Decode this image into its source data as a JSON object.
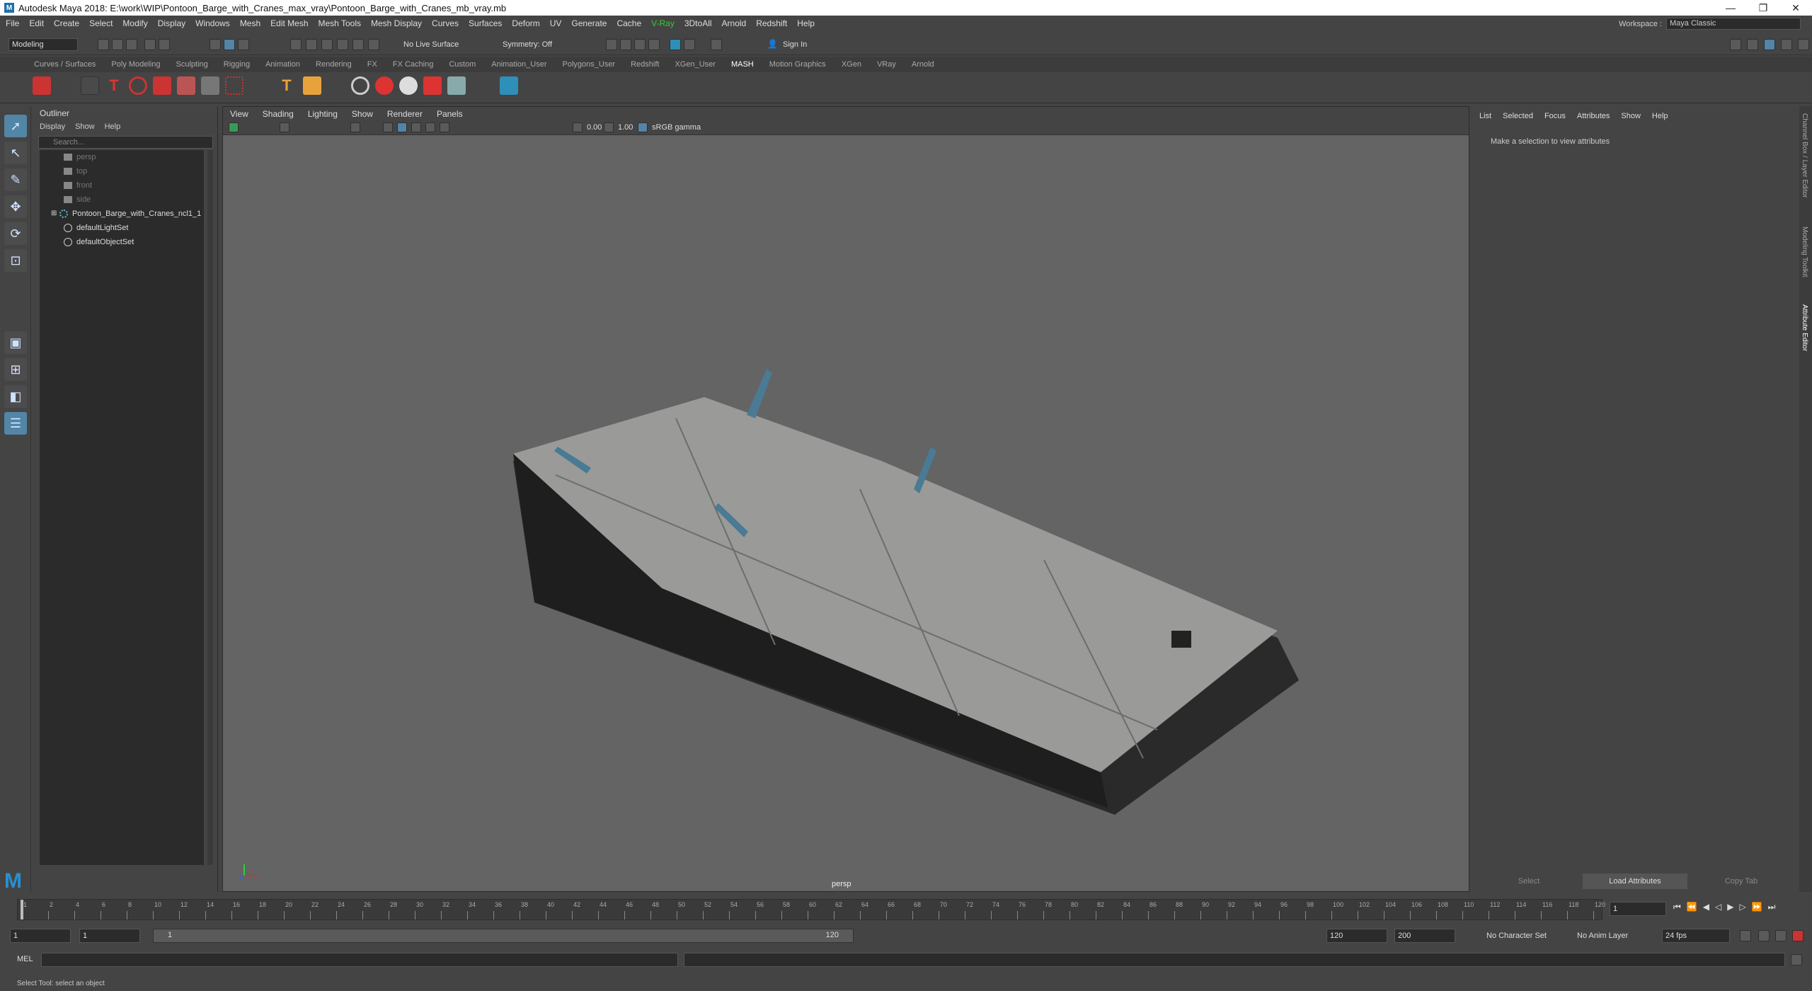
{
  "window": {
    "title": "Autodesk Maya 2018: E:\\work\\WIP\\Pontoon_Barge_with_Cranes_max_vray\\Pontoon_Barge_with_Cranes_mb_vray.mb",
    "minimize": "—",
    "restore": "❐",
    "close": "✕"
  },
  "menubar": [
    "File",
    "Edit",
    "Create",
    "Select",
    "Modify",
    "Display",
    "Windows",
    "Mesh",
    "Edit Mesh",
    "Mesh Tools",
    "Mesh Display",
    "Curves",
    "Surfaces",
    "Deform",
    "UV",
    "Generate",
    "Cache",
    "V-Ray",
    "3DtoAll",
    "Arnold",
    "Redshift",
    "Help"
  ],
  "workspace": {
    "label": "Workspace :",
    "value": "Maya Classic"
  },
  "statusline": {
    "mode": "Modeling",
    "live_surface": "No Live Surface",
    "symmetry": "Symmetry: Off",
    "sign_in": "Sign In"
  },
  "shelf_tabs": [
    "Curves / Surfaces",
    "Poly Modeling",
    "Sculpting",
    "Rigging",
    "Animation",
    "Rendering",
    "FX",
    "FX Caching",
    "Custom",
    "Animation_User",
    "Polygons_User",
    "Redshift",
    "XGen_User",
    "MASH",
    "Motion Graphics",
    "XGen",
    "VRay",
    "Arnold"
  ],
  "active_shelf": "MASH",
  "outliner": {
    "title": "Outliner",
    "menu": [
      "Display",
      "Show",
      "Help"
    ],
    "search_placeholder": "Search...",
    "items": [
      {
        "label": "persp",
        "icon": "camera-icon",
        "dim": true
      },
      {
        "label": "top",
        "icon": "camera-icon",
        "dim": true
      },
      {
        "label": "front",
        "icon": "camera-icon",
        "dim": true
      },
      {
        "label": "side",
        "icon": "camera-icon",
        "dim": true
      },
      {
        "label": "Pontoon_Barge_with_Cranes_ncl1_1",
        "icon": "group-icon",
        "dim": false
      },
      {
        "label": "defaultLightSet",
        "icon": "set-icon",
        "dim": false
      },
      {
        "label": "defaultObjectSet",
        "icon": "set-icon",
        "dim": false
      }
    ]
  },
  "viewport": {
    "menu": [
      "View",
      "Shading",
      "Lighting",
      "Show",
      "Renderer",
      "Panels"
    ],
    "exposure": "0.00",
    "gamma": "1.00",
    "color_space": "sRGB gamma",
    "camera_label": "persp"
  },
  "attribute_editor": {
    "menu": [
      "List",
      "Selected",
      "Focus",
      "Attributes",
      "Show",
      "Help"
    ],
    "message": "Make a selection to view attributes",
    "buttons": [
      "Select",
      "Load Attributes",
      "Copy Tab"
    ],
    "side_tabs": [
      "Channel Box / Layer Editor",
      "Modeling Toolkit",
      "Attribute Editor"
    ]
  },
  "timeline": {
    "ticks": [
      "1",
      "2",
      "4",
      "6",
      "8",
      "10",
      "12",
      "14",
      "16",
      "18",
      "20",
      "22",
      "24",
      "26",
      "28",
      "30",
      "32",
      "34",
      "36",
      "38",
      "40",
      "42",
      "44",
      "46",
      "48",
      "50",
      "52",
      "54",
      "56",
      "58",
      "60",
      "62",
      "64",
      "66",
      "68",
      "70",
      "72",
      "74",
      "76",
      "78",
      "80",
      "82",
      "84",
      "86",
      "88",
      "90",
      "92",
      "94",
      "96",
      "98",
      "100",
      "102",
      "104",
      "106",
      "108",
      "110",
      "112",
      "114",
      "116",
      "118",
      "120"
    ],
    "current_frame": "1"
  },
  "range": {
    "start": "1",
    "playback_start": "1",
    "slider_start": "1",
    "slider_end": "120",
    "playback_end": "120",
    "end": "200",
    "character_set": "No Character Set",
    "anim_layer": "No Anim Layer",
    "fps": "24 fps"
  },
  "command": {
    "label": "MEL"
  },
  "help_line": "Select Tool: select an object"
}
